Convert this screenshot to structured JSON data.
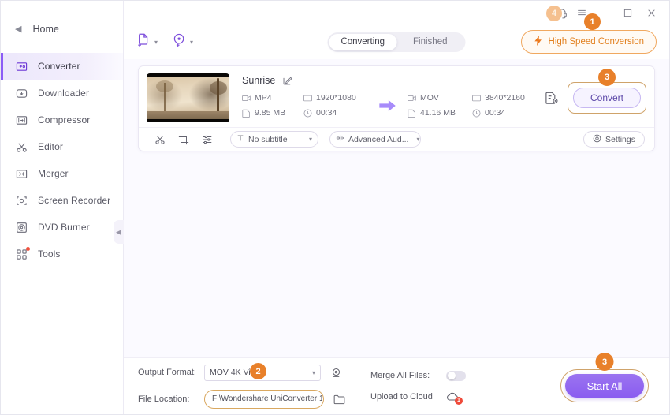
{
  "sidebar": {
    "back_label": "Home",
    "items": [
      {
        "label": "Converter",
        "icon": "converter-icon",
        "active": true
      },
      {
        "label": "Downloader",
        "icon": "downloader-icon",
        "active": false
      },
      {
        "label": "Compressor",
        "icon": "compressor-icon",
        "active": false
      },
      {
        "label": "Editor",
        "icon": "editor-scissors-icon",
        "active": false
      },
      {
        "label": "Merger",
        "icon": "merger-icon",
        "active": false
      },
      {
        "label": "Screen Recorder",
        "icon": "screen-recorder-icon",
        "active": false
      },
      {
        "label": "DVD Burner",
        "icon": "dvd-burner-icon",
        "active": false
      },
      {
        "label": "Tools",
        "icon": "tools-grid-icon",
        "active": false,
        "dot": true
      }
    ],
    "collapse_icon": "chevron-left-icon"
  },
  "titlebar": {
    "headset_icon": "headset-support-icon",
    "menu_icon": "hamburger-menu-icon",
    "minimize_icon": "minimize-icon",
    "maximize_icon": "maximize-icon",
    "close_icon": "close-icon"
  },
  "markers": {
    "m_headset": "4",
    "m_menu": "1",
    "m_convert": "3",
    "m_format": "2",
    "m_startall": "3"
  },
  "toolbar": {
    "add_file_icon": "add-file-icon",
    "add_dvd_icon": "add-dvd-icon",
    "caret": "▾",
    "tabs": [
      {
        "label": "Converting",
        "active": true
      },
      {
        "label": "Finished",
        "active": false
      }
    ],
    "high_speed_label": "High Speed Conversion",
    "high_speed_icon": "lightning-bolt-icon"
  },
  "file_card": {
    "thumbnail_alt": "sunrise-misty-trees-thumbnail",
    "name": "Sunrise",
    "edit_icon": "edit-pencil-icon",
    "source": {
      "format": "MP4",
      "resolution": "1920*1080",
      "size": "9.85 MB",
      "duration": "00:34"
    },
    "target": {
      "format": "MOV",
      "resolution": "3840*2160",
      "size": "41.16 MB",
      "duration": "00:34"
    },
    "arrow_icon": "arrow-right-icon",
    "file_settings_icon": "file-settings-icon",
    "convert_label": "Convert",
    "tools": [
      {
        "icon": "trim-scissors-icon"
      },
      {
        "icon": "crop-icon"
      },
      {
        "icon": "effect-lines-icon"
      }
    ],
    "subtitle_dropdown": {
      "icon": "subtitle-T-icon",
      "value": "No subtitle"
    },
    "audio_dropdown": {
      "icon": "audio-wave-icon",
      "value": "Advanced Aud..."
    },
    "settings_label": "Settings",
    "settings_icon": "target-gear-icon"
  },
  "bottom": {
    "output_format_label": "Output Format:",
    "output_format_value": "MOV 4K Vide",
    "output_format_side_icon": "format-preview-icon",
    "file_location_label": "File Location:",
    "file_location_value": "F:\\Wondershare UniConverter 1",
    "file_location_side_icon": "folder-icon",
    "merge_label": "Merge All Files:",
    "merge_enabled": false,
    "upload_label": "Upload to Cloud",
    "upload_icon": "cloud-upload-icon",
    "upload_badge": "1",
    "start_all_label": "Start All",
    "caret": "▾"
  }
}
